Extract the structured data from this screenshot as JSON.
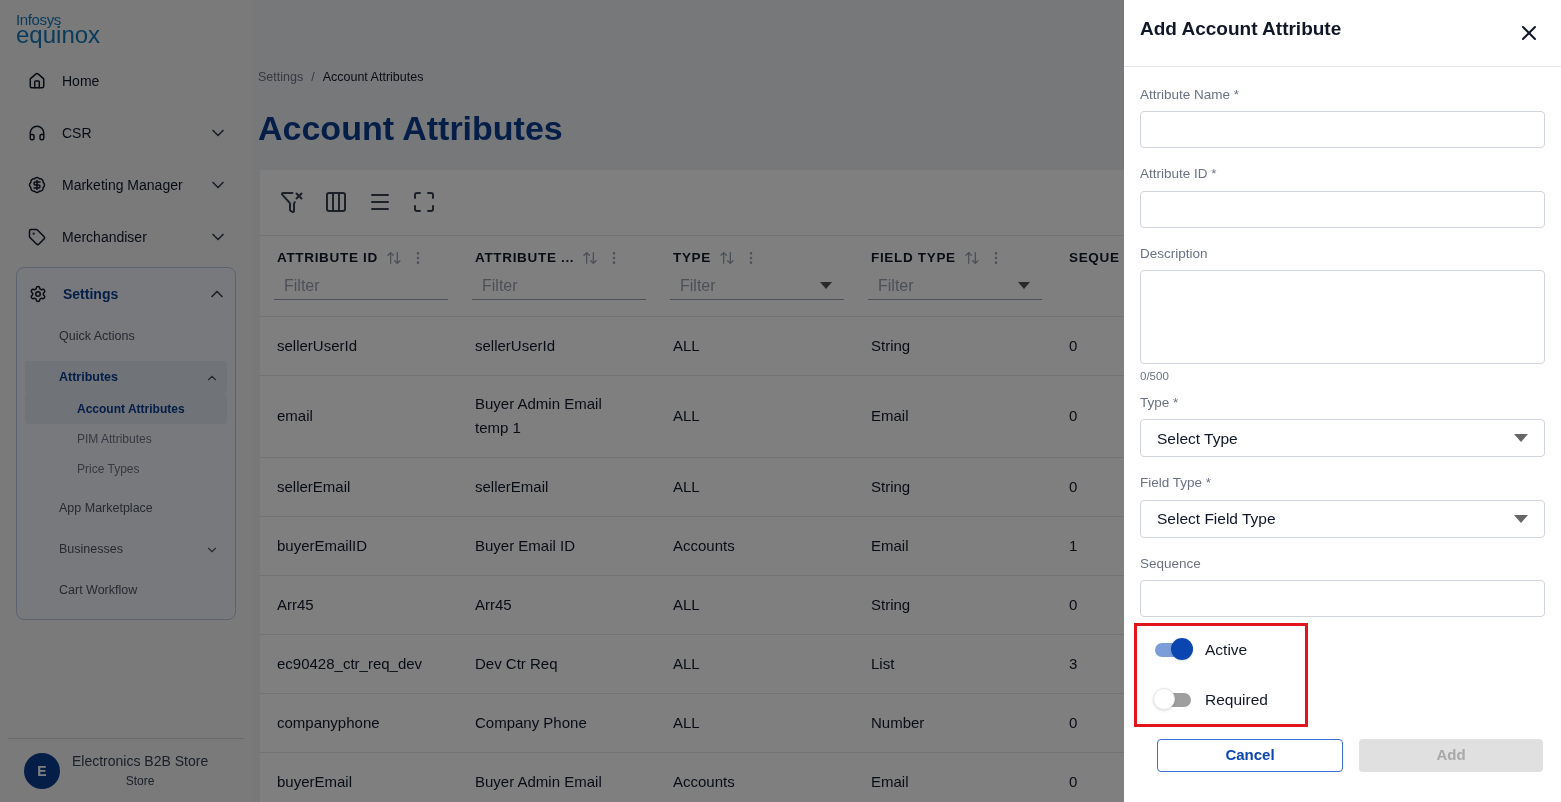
{
  "logo": {
    "top": "Infosys",
    "bottom": "equinox"
  },
  "sidebar": {
    "items": [
      {
        "label": "Home",
        "selected": false
      },
      {
        "label": "CSR",
        "selected": false,
        "expanded": false
      },
      {
        "label": "Marketing Manager",
        "selected": false,
        "expanded": false
      },
      {
        "label": "Merchandiser",
        "selected": false,
        "expanded": false
      },
      {
        "label": "Settings",
        "selected": true,
        "expanded": true,
        "children": [
          {
            "label": "Quick Actions",
            "selected": false
          },
          {
            "label": "Attributes",
            "selected": true,
            "expanded": true,
            "children": [
              {
                "label": "Account Attributes",
                "selected": true
              },
              {
                "label": "PIM Attributes",
                "selected": false
              },
              {
                "label": "Price Types",
                "selected": false
              }
            ]
          },
          {
            "label": "App Marketplace",
            "selected": false
          },
          {
            "label": "Businesses",
            "selected": false,
            "expanded": false
          },
          {
            "label": "Cart Workflow",
            "selected": false
          }
        ]
      }
    ],
    "store": {
      "initial": "E",
      "name": "Electronics B2B Store",
      "role": "Store"
    }
  },
  "breadcrumb": [
    "Settings",
    "/",
    "Account Attributes"
  ],
  "page_title": "Account Attributes",
  "table": {
    "columns": [
      {
        "label": "ATTRIBUTE ID",
        "filter": "Filter",
        "kind": "text"
      },
      {
        "label": "ATTRIBUTE ...",
        "filter": "Filter",
        "kind": "text"
      },
      {
        "label": "TYPE",
        "filter": "Filter",
        "kind": "select"
      },
      {
        "label": "FIELD TYPE",
        "filter": "Filter",
        "kind": "select"
      },
      {
        "label": "SEQUE"
      }
    ],
    "rows": [
      [
        "sellerUserId",
        "sellerUserId",
        "ALL",
        "String",
        "0"
      ],
      [
        "email",
        "Buyer Admin Email temp 1",
        "ALL",
        "Email",
        "0"
      ],
      [
        "sellerEmail",
        "sellerEmail",
        "ALL",
        "String",
        "0"
      ],
      [
        "buyerEmailID",
        "Buyer Email ID",
        "Accounts",
        "Email",
        "1"
      ],
      [
        "Arr45",
        "Arr45",
        "ALL",
        "String",
        "0"
      ],
      [
        "ec90428_ctr_req_dev",
        "Dev Ctr Req",
        "ALL",
        "List",
        "3"
      ],
      [
        "companyphone",
        "Company Phone",
        "ALL",
        "Number",
        "0"
      ],
      [
        "buyerEmail",
        "Buyer Admin Email",
        "Accounts",
        "Email",
        "0"
      ]
    ]
  },
  "drawer": {
    "title": "Add Account Attribute",
    "fields": [
      {
        "label": "Attribute Name *",
        "kind": "text"
      },
      {
        "label": "Attribute ID *",
        "kind": "text"
      },
      {
        "label": "Description",
        "kind": "textarea",
        "counter": "0/500"
      },
      {
        "label": "Type *",
        "kind": "select",
        "value": "Select Type"
      },
      {
        "label": "Field Type *",
        "kind": "select",
        "value": "Select Field Type"
      },
      {
        "label": "Sequence",
        "kind": "text"
      }
    ],
    "toggles": [
      {
        "label": "Active",
        "on": true
      },
      {
        "label": "Required",
        "on": false
      }
    ],
    "toggles_highlighted": true,
    "buttons": [
      {
        "label": "Cancel",
        "kind": "outline"
      },
      {
        "label": "Add",
        "kind": "primary",
        "disabled": true
      }
    ]
  }
}
